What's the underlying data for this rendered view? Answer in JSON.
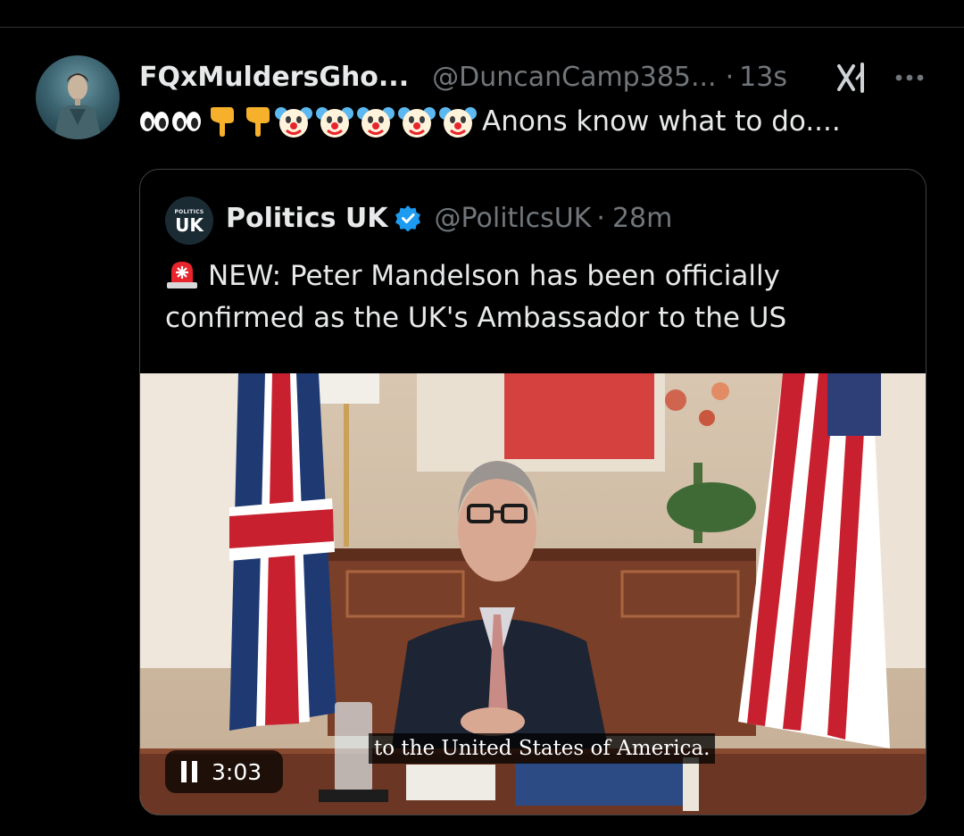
{
  "tweet": {
    "display_name": "FQxMuldersGho...",
    "handle": "@DuncanCamp385...",
    "separator": "·",
    "time": "13s",
    "text": "Anons know what to do....",
    "emoji_icons": [
      "eyes-icon",
      "eyes-icon",
      "pointing-down-icon",
      "pointing-down-icon",
      "clown-face-icon",
      "clown-face-icon",
      "clown-face-icon",
      "clown-face-icon",
      "clown-face-icon"
    ]
  },
  "quoted_tweet": {
    "avatar_small_text": "POLITICS",
    "avatar_text": "UK",
    "display_name": "Politics UK",
    "handle": "@PolitlcsUK",
    "separator": "·",
    "time": "28m",
    "text": "NEW: Peter Mandelson has been officially confirmed as the UK's Ambassador to the US",
    "text_icon": "siren-icon"
  },
  "video": {
    "caption": "to the United States of America.",
    "duration": "3:03",
    "state_icon": "pause-icon"
  },
  "icons": {
    "verified": "verified-badge-icon",
    "grok": "grok-icon",
    "more": "more-options-icon"
  },
  "colors": {
    "background": "#000000",
    "text_primary": "#e7e9ea",
    "text_secondary": "#71767b",
    "verified_blue": "#1d9bf0",
    "border": "#3e4144"
  }
}
